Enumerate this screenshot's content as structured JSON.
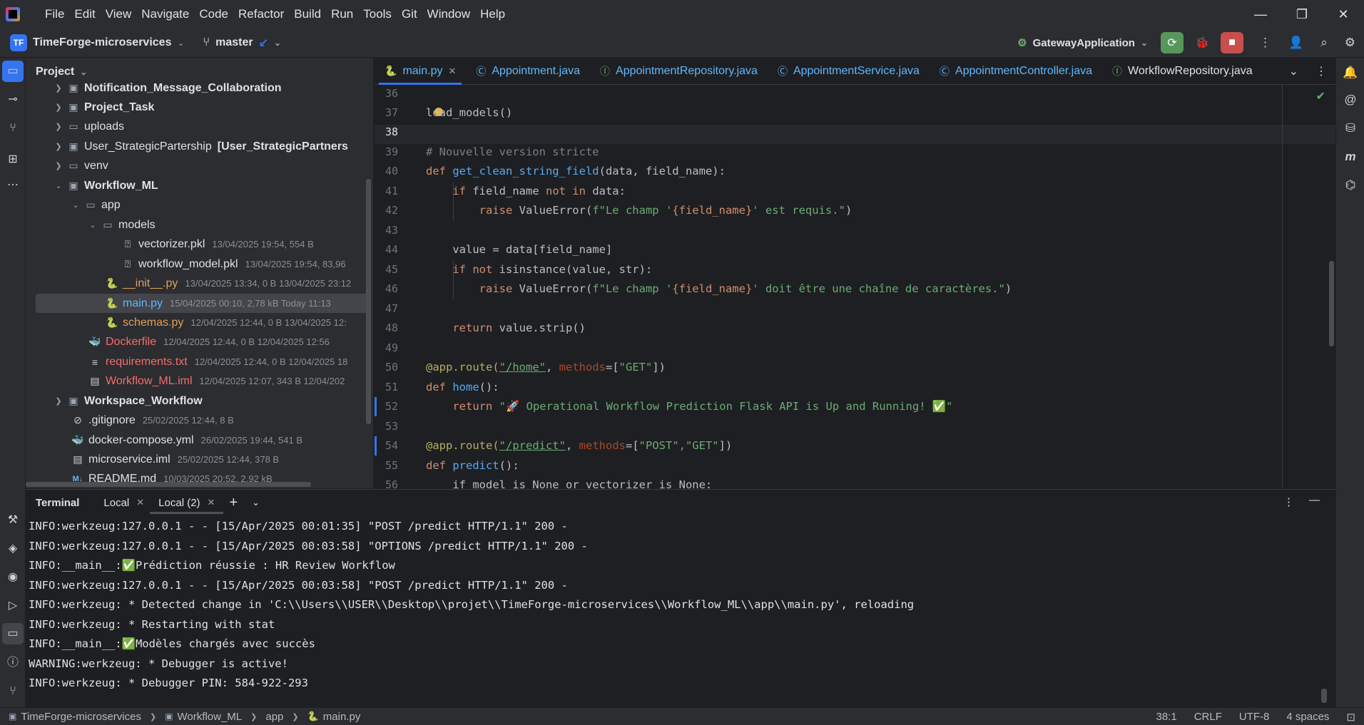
{
  "app": {
    "menu": [
      "File",
      "Edit",
      "View",
      "Navigate",
      "Code",
      "Refactor",
      "Build",
      "Run",
      "Tools",
      "Git",
      "Window",
      "Help"
    ]
  },
  "toolbar": {
    "project_badge": "TF",
    "project_name": "TimeForge-microservices",
    "branch": "master",
    "run_config": "GatewayApplication"
  },
  "project_panel": {
    "title": "Project",
    "items": [
      {
        "name": "Notification_Message_Collaboration",
        "meta": "",
        "y": 0
      },
      {
        "name": "Project_Task",
        "meta": ""
      },
      {
        "name": "uploads",
        "meta": ""
      },
      {
        "name": "User_StrategicPartership",
        "meta": "[User_StrategicPartners"
      },
      {
        "name": "venv",
        "meta": ""
      },
      {
        "name": "Workflow_ML",
        "meta": ""
      },
      {
        "name": "app",
        "meta": ""
      },
      {
        "name": "models",
        "meta": ""
      },
      {
        "name": "vectorizer.pkl",
        "meta": "13/04/2025 19:54, 554 B"
      },
      {
        "name": "workflow_model.pkl",
        "meta": "13/04/2025 19:54, 83,96"
      },
      {
        "name": "__init__.py",
        "meta": "13/04/2025 13:34, 0 B 13/04/2025 23:12"
      },
      {
        "name": "main.py",
        "meta": "15/04/2025 00:10, 2,78 kB Today 11:13"
      },
      {
        "name": "schemas.py",
        "meta": "12/04/2025 12:44, 0 B 13/04/2025 12:"
      },
      {
        "name": "Dockerfile",
        "meta": "12/04/2025 12:44, 0 B 12/04/2025 12:56"
      },
      {
        "name": "requirements.txt",
        "meta": "12/04/2025 12:44, 0 B 12/04/2025 18"
      },
      {
        "name": "Workflow_ML.iml",
        "meta": "12/04/2025 12:07, 343 B 12/04/202"
      },
      {
        "name": "Workspace_Workflow",
        "meta": ""
      },
      {
        "name": ".gitignore",
        "meta": "25/02/2025 12:44, 8 B"
      },
      {
        "name": "docker-compose.yml",
        "meta": "26/02/2025 19:44, 541 B"
      },
      {
        "name": "microservice.iml",
        "meta": "25/02/2025 12:44, 378 B"
      },
      {
        "name": "README.md",
        "meta": "10/03/2025 20:52, 2,92 kB"
      }
    ]
  },
  "editor": {
    "tabs": [
      "main.py",
      "Appointment.java",
      "AppointmentRepository.java",
      "AppointmentService.java",
      "AppointmentController.java",
      "WorkflowRepository.java"
    ],
    "line_numbers": [
      "36",
      "37",
      "38",
      "39",
      "40",
      "41",
      "42",
      "43",
      "44",
      "45",
      "46",
      "47",
      "48",
      "49",
      "50",
      "51",
      "52",
      "53",
      "54",
      "55",
      "56"
    ],
    "code": {
      "l37": "load_models()",
      "l39": "# Nouvelle version stricte",
      "l40a": "def ",
      "l40b": "get_clean_string_field",
      "l40c": "(data, field_name):",
      "l41a": "    if ",
      "l41b": "field_name ",
      "l41c": "not in ",
      "l41d": "data:",
      "l42a": "        raise ",
      "l42b": "ValueError(",
      "l42c": "f\"Le champ '",
      "l42d": "{field_name}",
      "l42e": "' est requis.\"",
      "l42f": ")",
      "l44": "    value = data[field_name]",
      "l45a": "    if not ",
      "l45b": "isinstance(value, str):",
      "l46a": "        raise ",
      "l46b": "ValueError(",
      "l46c": "f\"Le champ '",
      "l46d": "{field_name}",
      "l46e": "' doit être une chaîne de caractères.\"",
      "l46f": ")",
      "l48a": "    return ",
      "l48b": "value.strip()",
      "l50a": "@app.route(",
      "l50b": "\"/home\"",
      "l50c": ", ",
      "l50d": "methods",
      "l50e": "=[",
      "l50f": "\"GET\"",
      "l50g": "])",
      "l51a": "def ",
      "l51b": "home",
      "l51c": "():",
      "l52a": "    return ",
      "l52b": "\"🚀 Operational Workflow Prediction Flask API is Up and Running! ✅\"",
      "l54a": "@app.route(",
      "l54b": "\"/predict\"",
      "l54c": ", ",
      "l54d": "methods",
      "l54e": "=[",
      "l54f": "\"POST\",\"GET\"",
      "l54g": "])",
      "l55a": "def ",
      "l55b": "predict",
      "l55c": "():",
      "l56": "    if model is None or vectorizer is None:"
    }
  },
  "terminal": {
    "title": "Terminal",
    "tabs": [
      "Local",
      "Local (2)"
    ],
    "lines": [
      "INFO:werkzeug:127.0.0.1 - - [15/Apr/2025 00:01:35] \"POST /predict HTTP/1.1\" 200 -",
      "INFO:werkzeug:127.0.0.1 - - [15/Apr/2025 00:03:58] \"OPTIONS /predict HTTP/1.1\" 200 -",
      "INFO:__main__:✅Prédiction réussie : HR Review Workflow",
      "INFO:werkzeug:127.0.0.1 - - [15/Apr/2025 00:03:58] \"POST /predict HTTP/1.1\" 200 -",
      "INFO:werkzeug: * Detected change in 'C:\\\\Users\\\\USER\\\\Desktop\\\\projet\\\\TimeForge-microservices\\\\Workflow_ML\\\\app\\\\main.py', reloading",
      "INFO:werkzeug: * Restarting with stat",
      "INFO:__main__:✅Modèles chargés avec succès",
      "WARNING:werkzeug: * Debugger is active!",
      "INFO:werkzeug: * Debugger PIN: 584-922-293"
    ]
  },
  "statusbar": {
    "crumbs": [
      "TimeForge-microservices",
      "Workflow_ML",
      "app",
      "main.py"
    ],
    "position": "38:1",
    "line_sep": "CRLF",
    "encoding": "UTF-8",
    "indent": "4 spaces"
  }
}
